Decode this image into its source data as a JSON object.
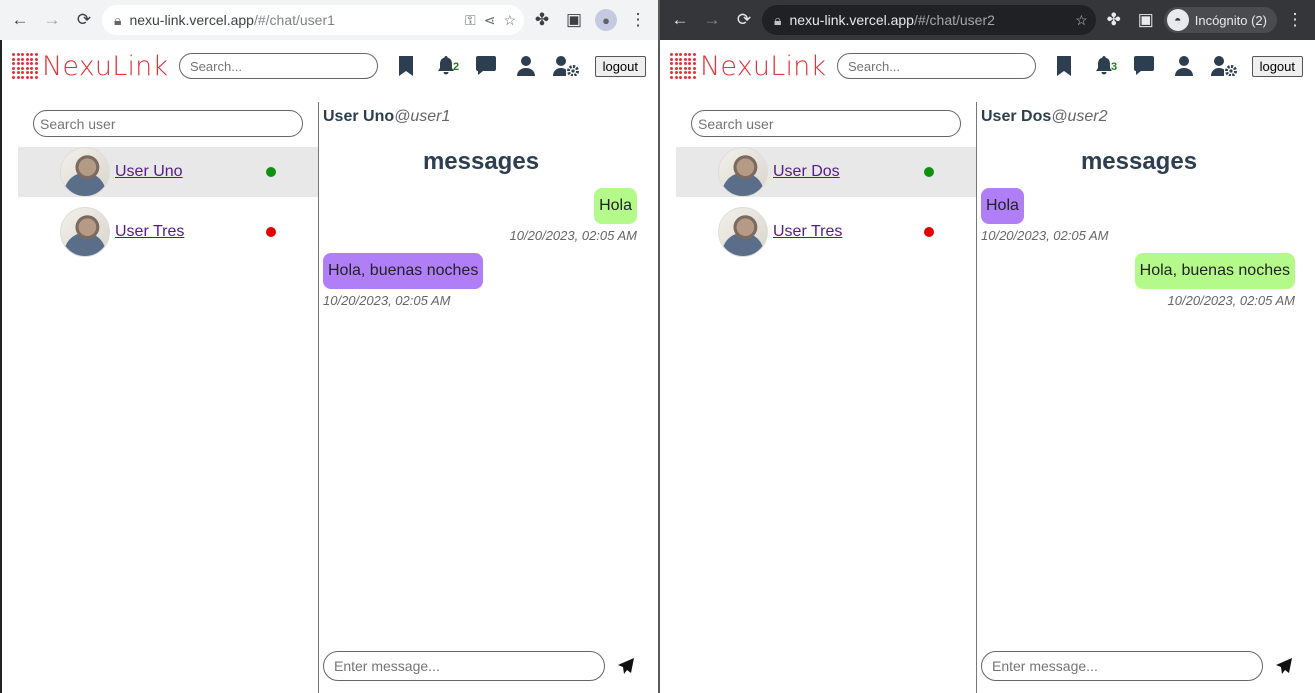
{
  "left": {
    "browser": {
      "url_host": "nexu-link.vercel.app",
      "url_path": "/#/chat/user1"
    },
    "nav": {
      "logo": "NexuLink",
      "search_placeholder": "Search...",
      "notif_count": "2",
      "logout": "logout"
    },
    "sidebar": {
      "search_placeholder": "Search user",
      "users": [
        {
          "name": "User Uno",
          "status": "online"
        },
        {
          "name": "User Tres",
          "status": "offline"
        }
      ]
    },
    "chat": {
      "name": "User Uno",
      "handle": "@user1",
      "title": "messages",
      "messages": [
        {
          "text": "Hola",
          "time": "10/20/2023, 02:05 AM",
          "side": "mine"
        },
        {
          "text": "Hola, buenas noches",
          "time": "10/20/2023, 02:05 AM",
          "side": "theirs"
        }
      ],
      "input_placeholder": "Enter message..."
    }
  },
  "right": {
    "browser": {
      "url_host": "nexu-link.vercel.app",
      "url_path": "/#/chat/user2",
      "incognito": "Incógnito (2)"
    },
    "nav": {
      "logo": "NexuLink",
      "search_placeholder": "Search...",
      "notif_count": "3",
      "logout": "logout"
    },
    "sidebar": {
      "search_placeholder": "Search user",
      "users": [
        {
          "name": "User Dos",
          "status": "online"
        },
        {
          "name": "User Tres",
          "status": "offline"
        }
      ]
    },
    "chat": {
      "name": "User Dos",
      "handle": "@user2",
      "title": "messages",
      "messages": [
        {
          "text": "Hola",
          "time": "10/20/2023, 02:05 AM",
          "side": "theirs"
        },
        {
          "text": "Hola, buenas noches",
          "time": "10/20/2023, 02:05 AM",
          "side": "mine"
        }
      ],
      "input_placeholder": "Enter message..."
    }
  },
  "colors": {
    "brand": "#e0343a",
    "mine_bubble": "#b4fa8a",
    "their_bubble": "#b07ef7",
    "online": "#109010",
    "offline": "#e00000"
  }
}
